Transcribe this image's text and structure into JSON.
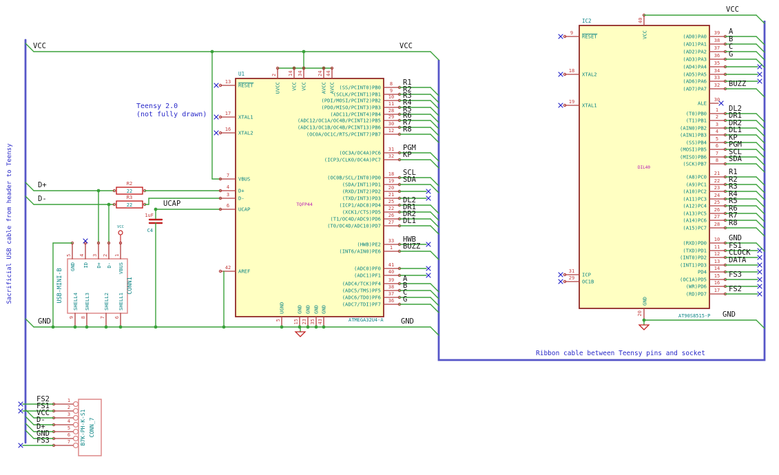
{
  "colors": {
    "wire": "#3aa13a",
    "bus": "#5656c8",
    "pin_stub": "#b03c3c",
    "pin_number": "#c33c3c",
    "pin_name": "#0d8585",
    "net_label": "#151515",
    "note": "#2828c8",
    "ref_text": "#0d8585",
    "footprint_text": "#b515b5",
    "device_outline": "#c12020",
    "connector_outline": "#dd8888",
    "ic_fill": "#ffffc2",
    "ic_border": "#8a1c1c",
    "no_connect": "#2525c8"
  },
  "notes": {
    "teensy_line1": "Teensy 2.0",
    "teensy_line2": "(not fully drawn)",
    "ribbon": "Ribbon cable between Teensy pins and socket",
    "usb_cable": "Sacrificial USB cable from header to Teensy"
  },
  "net_labels": {
    "vcc": "VCC",
    "gnd": "GND",
    "dplus": "D+",
    "dminus": "D-",
    "ucap": "UCAP"
  },
  "u1": {
    "ref": "U1",
    "footprint": "TQFP44",
    "value": "ATMEGA32U4-A",
    "left_pins": [
      {
        "num": "13",
        "name": "RESET",
        "overline": true,
        "conn": "nc"
      },
      {
        "num": "17",
        "name": "XTAL1",
        "conn": "nc"
      },
      {
        "num": "16",
        "name": "XTAL2",
        "conn": "nc"
      },
      {
        "num": "7",
        "name": "VBUS",
        "conn": "wire"
      },
      {
        "num": "4",
        "name": "D+",
        "conn": "wire"
      },
      {
        "num": "3",
        "name": "D-",
        "conn": "wire"
      },
      {
        "num": "6",
        "name": "UCAP",
        "conn": "wire"
      },
      {
        "num": "42",
        "name": "AREF",
        "conn": "wire"
      }
    ],
    "top_pins": [
      {
        "num": "2",
        "name": "UVCC"
      },
      {
        "num": "14",
        "name": "VCC"
      },
      {
        "num": "34",
        "name": "VCC"
      },
      {
        "num": "24",
        "name": "AVCC"
      },
      {
        "num": "44",
        "name": "AVCC"
      }
    ],
    "bottom_pins": [
      {
        "num": "5",
        "name": "UGND"
      },
      {
        "num": "15",
        "name": "GND"
      },
      {
        "num": "23",
        "name": "GND"
      },
      {
        "num": "35",
        "name": "GND"
      },
      {
        "num": "43",
        "name": "GND"
      }
    ],
    "right_pins": [
      {
        "num": "8",
        "name": "(SS/PCINT0)PB0",
        "label": "R1",
        "conn": "bus"
      },
      {
        "num": "9",
        "name": "(SCLK/PCINT1)PB1",
        "label": "R2",
        "conn": "bus"
      },
      {
        "num": "10",
        "name": "(PDI/MOSI/PCINT2)PB2",
        "label": "R3",
        "conn": "bus"
      },
      {
        "num": "11",
        "name": "(PDO/MISO/PCINT3)PB3",
        "label": "R4",
        "conn": "bus"
      },
      {
        "num": "28",
        "name": "(ADC11/PCINT4)PB4",
        "label": "R5",
        "conn": "bus"
      },
      {
        "num": "29",
        "name": "(ADC12/OC1A/OC4B/PCINT12)PB5",
        "label": "R6",
        "conn": "bus"
      },
      {
        "num": "30",
        "name": "(ADC13/OC1B/OC4B/PCINT13)PB6",
        "label": "R7",
        "conn": "bus"
      },
      {
        "num": "12",
        "name": "(OC0A/OC1C/RTS/PCINT7)PB7",
        "label": "R8",
        "conn": "bus"
      },
      {
        "num": "31",
        "name": "(OC3A/OC4A)PC6",
        "label": "PGM",
        "conn": "bus"
      },
      {
        "num": "32",
        "name": "(ICP3/CLK0/OC4A)PC7",
        "label": "KP",
        "conn": "bus"
      },
      {
        "num": "18",
        "name": "(OC0B/SCL/INT0)PD0",
        "label": "SCL",
        "conn": "bus"
      },
      {
        "num": "19",
        "name": "(SDA/INT1)PD1",
        "label": "SDA",
        "conn": "bus"
      },
      {
        "num": "20",
        "name": "(RXD/INT2)PD2",
        "label": "",
        "conn": "nc"
      },
      {
        "num": "21",
        "name": "(TXD/INT3)PD3",
        "label": "",
        "conn": "nc"
      },
      {
        "num": "25",
        "name": "(ICP1/ADC8)PD4",
        "label": "DL2",
        "conn": "bus"
      },
      {
        "num": "22",
        "name": "(XCK1/CTS)PD5",
        "label": "DR1",
        "conn": "bus"
      },
      {
        "num": "26",
        "name": "(T1/OC4D/ADC9)PD6",
        "label": "DR2",
        "conn": "bus"
      },
      {
        "num": "27",
        "name": "(T0/OC4D/ADC10)PD7",
        "label": "DL1",
        "conn": "bus"
      },
      {
        "num": "33",
        "name": "(HWB)PE2",
        "label": "HWB",
        "conn": "nc"
      },
      {
        "num": "1",
        "name": "(INT6/AIN0)PE6",
        "label": "BUZZ",
        "conn": "bus"
      },
      {
        "num": "41",
        "name": "(ADC0)PF0",
        "label": "",
        "conn": "nc"
      },
      {
        "num": "40",
        "name": "(ADC1)PF1",
        "label": "",
        "conn": "nc"
      },
      {
        "num": "39",
        "name": "(ADC4/TCK)PF4",
        "label": "A",
        "conn": "bus"
      },
      {
        "num": "38",
        "name": "(ADC5/TMS)PF5",
        "label": "B",
        "conn": "bus"
      },
      {
        "num": "37",
        "name": "(ADC6/TDO)PF6",
        "label": "C",
        "conn": "bus"
      },
      {
        "num": "36",
        "name": "(ADC7/TDI)PF7",
        "label": "G",
        "conn": "bus"
      }
    ]
  },
  "ic2": {
    "ref": "IC2",
    "footprint": "DIL40",
    "value": "AT90S8515-P",
    "left_pins": [
      {
        "num": "9",
        "name": "RESET",
        "overline": true
      },
      {
        "num": "18",
        "name": "XTAL2"
      },
      {
        "num": "19",
        "name": "XTAL1"
      },
      {
        "num": "31",
        "name": "ICP"
      },
      {
        "num": "29",
        "name": "OC1B"
      }
    ],
    "top_pins": [
      {
        "num": "40",
        "name": "VCC"
      }
    ],
    "bottom_pins": [
      {
        "num": "20",
        "name": "GND"
      }
    ],
    "right_pins": [
      {
        "num": "39",
        "name": "(AD0)PA0",
        "label": "A",
        "conn": "bus"
      },
      {
        "num": "38",
        "name": "(AD1)PA1",
        "label": "B",
        "conn": "bus"
      },
      {
        "num": "37",
        "name": "(AD2)PA2",
        "label": "C",
        "conn": "bus"
      },
      {
        "num": "36",
        "name": "(AD3)PA3",
        "label": "G",
        "conn": "bus"
      },
      {
        "num": "35",
        "name": "(AD4)PA4",
        "label": "",
        "conn": "nc"
      },
      {
        "num": "34",
        "name": "(AD5)PA5",
        "label": "",
        "conn": "nc"
      },
      {
        "num": "33",
        "name": "(AD6)PA6",
        "label": "",
        "conn": "nc"
      },
      {
        "num": "32",
        "name": "(AD7)PA7",
        "label": "BUZZ",
        "conn": "bus"
      },
      {
        "num": "30",
        "name": "ALE",
        "label": "",
        "conn": "nc_short"
      },
      {
        "num": "1",
        "name": "(T0)PB0",
        "label": "DL2",
        "conn": "bus"
      },
      {
        "num": "2",
        "name": "(T1)PB1",
        "label": "DR1",
        "conn": "bus"
      },
      {
        "num": "3",
        "name": "(AIN0)PB2",
        "label": "DR2",
        "conn": "bus"
      },
      {
        "num": "4",
        "name": "(AIN1)PB3",
        "label": "DL1",
        "conn": "bus"
      },
      {
        "num": "5",
        "name": "(SS)PB4",
        "label": "KP",
        "conn": "bus"
      },
      {
        "num": "6",
        "name": "(MOSI)PB5",
        "label": "PGM",
        "conn": "bus"
      },
      {
        "num": "7",
        "name": "(MISO)PB6",
        "label": "SCL",
        "conn": "bus"
      },
      {
        "num": "8",
        "name": "(SCK)PB7",
        "label": "SDA",
        "conn": "bus"
      },
      {
        "num": "21",
        "name": "(A8)PC0",
        "label": "R1",
        "conn": "bus"
      },
      {
        "num": "22",
        "name": "(A9)PC1",
        "label": "R2",
        "conn": "bus"
      },
      {
        "num": "23",
        "name": "(A10)PC2",
        "label": "R3",
        "conn": "bus"
      },
      {
        "num": "24",
        "name": "(A11)PC3",
        "label": "R4",
        "conn": "bus"
      },
      {
        "num": "25",
        "name": "(A12)PC4",
        "label": "R5",
        "conn": "bus"
      },
      {
        "num": "26",
        "name": "(A13)PC5",
        "label": "R6",
        "conn": "bus"
      },
      {
        "num": "27",
        "name": "(A14)PC6",
        "label": "R7",
        "conn": "bus"
      },
      {
        "num": "28",
        "name": "(A15)PC7",
        "label": "R8",
        "conn": "bus"
      },
      {
        "num": "10",
        "name": "(RXD)PD0",
        "label": "GND",
        "conn": "bus"
      },
      {
        "num": "11",
        "name": "(TXD)PD1",
        "label": "FS1",
        "conn": "nc"
      },
      {
        "num": "12",
        "name": "(INT0)PD2",
        "label": "CLOCK",
        "conn": "nc"
      },
      {
        "num": "13",
        "name": "(INT1)PD3",
        "label": "DATA",
        "conn": "nc"
      },
      {
        "num": "14",
        "name": "PD4",
        "label": "",
        "conn": "nc"
      },
      {
        "num": "15",
        "name": "(OC1A)PD5",
        "label": "FS3",
        "conn": "nc"
      },
      {
        "num": "16",
        "name": "(WR)PD6",
        "label": "",
        "conn": "nc"
      },
      {
        "num": "17",
        "name": "(RD)PD7",
        "label": "FS2",
        "conn": "nc"
      }
    ]
  },
  "con1": {
    "ref": "CONN1",
    "value": "USB-MINI-B",
    "top_pins": [
      {
        "num": "5",
        "name": "GND"
      },
      {
        "num": "4",
        "name": "ID"
      },
      {
        "num": "3",
        "name": "D+"
      },
      {
        "num": "2",
        "name": "D-"
      },
      {
        "num": "1",
        "name": "VBUS"
      }
    ],
    "bottom_pins": [
      {
        "num": "9",
        "name": "SHELL4"
      },
      {
        "num": "8",
        "name": "SHELL3"
      },
      {
        "num": "7",
        "name": "SHELL2"
      },
      {
        "num": "6",
        "name": "SHELL1"
      }
    ]
  },
  "conn7": {
    "ref": "CONN_7",
    "value": "B7K-PH-K-S1",
    "pins": [
      {
        "num": "1",
        "label": "FS2",
        "conn": "nc"
      },
      {
        "num": "2",
        "label": "FS1",
        "conn": "nc"
      },
      {
        "num": "3",
        "label": "VCC",
        "conn": "bus"
      },
      {
        "num": "4",
        "label": "D-",
        "conn": "bus"
      },
      {
        "num": "5",
        "label": "D+",
        "conn": "bus"
      },
      {
        "num": "6",
        "label": "GND",
        "conn": "bus"
      },
      {
        "num": "7",
        "label": "FS3",
        "conn": "nc"
      }
    ]
  },
  "r2": {
    "ref": "R2",
    "value": "22"
  },
  "r3": {
    "ref": "R3",
    "value": "22"
  },
  "c4": {
    "ref": "C4",
    "value": "1uF"
  },
  "vcc_symbol": {
    "label": "VCC"
  }
}
